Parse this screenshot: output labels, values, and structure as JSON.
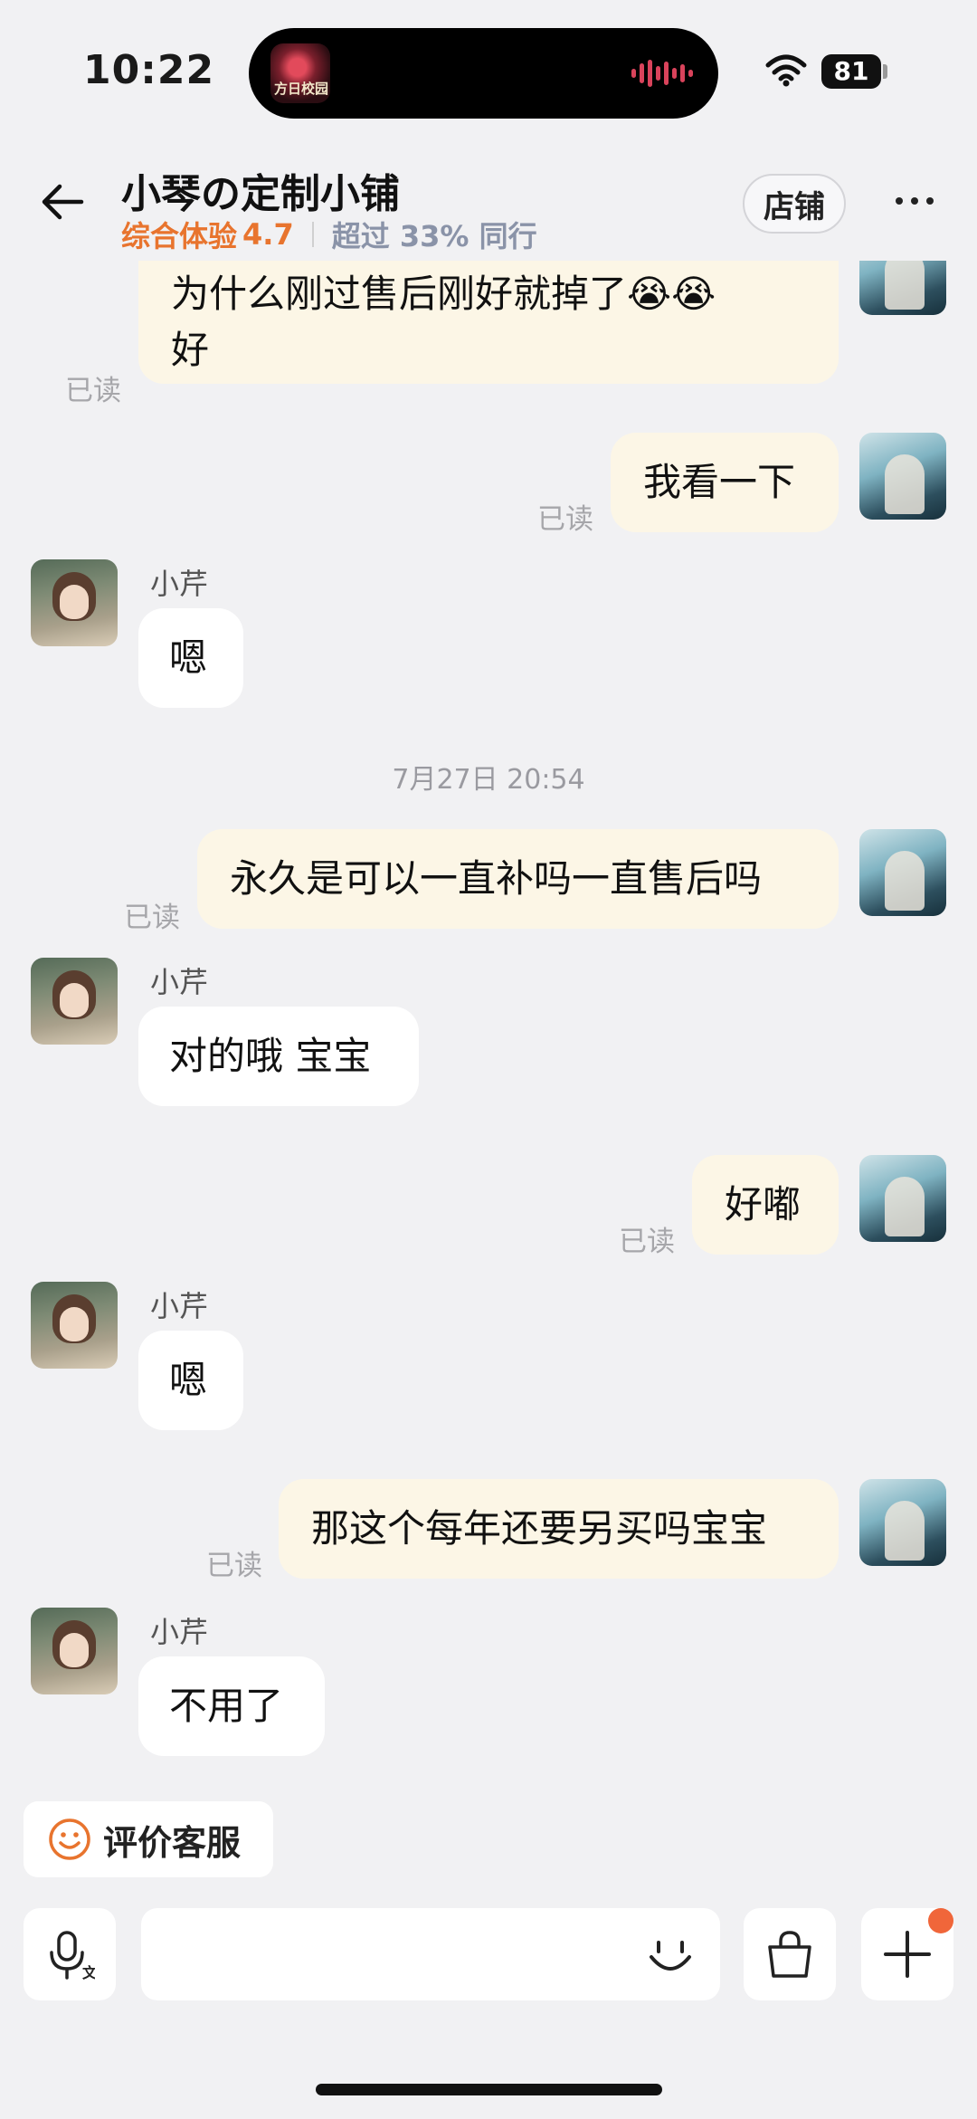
{
  "status_bar": {
    "time": "10:22",
    "battery": "81",
    "island_art_text": "方日校园"
  },
  "header": {
    "title": "小琴の定制小铺",
    "rating_label": "综合体验",
    "rating_value": "4.7",
    "compare_text": "超过 33% 同行",
    "store_button": "店铺"
  },
  "chat": {
    "read_label": "已读",
    "agent_name": "小芹",
    "timestamp": "7月27日 20:54",
    "messages": [
      {
        "side": "out",
        "lines": [
          "为什么刚过售后刚好就掉了😭😭",
          "好"
        ]
      },
      {
        "side": "out",
        "text": "我看一下"
      },
      {
        "side": "in",
        "text": "嗯"
      },
      {
        "side": "out",
        "text": "永久是可以一直补吗一直售后吗"
      },
      {
        "side": "in",
        "text": "对的哦 宝宝"
      },
      {
        "side": "out",
        "text": "好嘟"
      },
      {
        "side": "in",
        "text": "嗯"
      },
      {
        "side": "out",
        "text": "那这个每年还要另买吗宝宝"
      },
      {
        "side": "in",
        "text": "不用了"
      }
    ]
  },
  "bottom": {
    "rate_button": "评价客服",
    "input_placeholder": ""
  },
  "colors": {
    "accent_orange": "#e8742e",
    "out_bubble": "#fcf6e6",
    "in_bubble": "#ffffff",
    "background": "#f1f1f3",
    "notification_dot": "#f0663a"
  }
}
